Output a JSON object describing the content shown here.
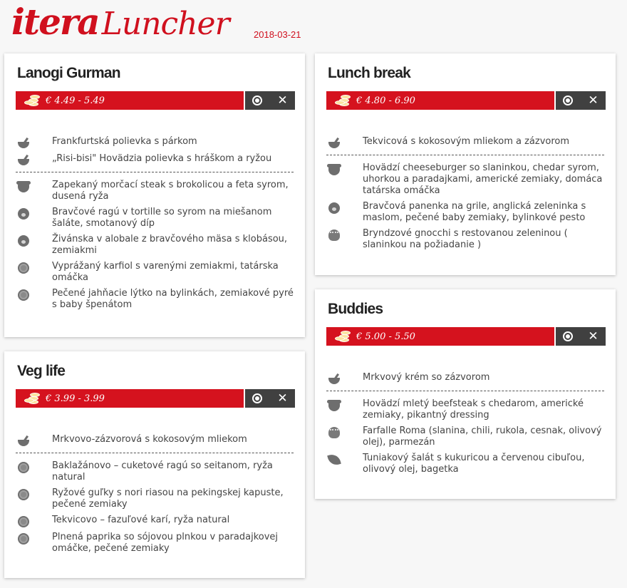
{
  "app": {
    "brand_part1": "itera",
    "brand_part2": "Luncher",
    "date": "2018-03-21"
  },
  "colors": {
    "accent": "#d5121e",
    "action_bar": "#404040"
  },
  "restaurants": {
    "lanogi": {
      "name": "Lanogi Gurman",
      "price": "€ 4.49 - 5.49",
      "soups": [
        {
          "icon": "soup-icon",
          "text": "Frankfurtská polievka s párkom"
        },
        {
          "icon": "soup-icon",
          "text": "„Risi-bisi\" Hovädzia polievka s hráškom a ryžou"
        }
      ],
      "mains": [
        {
          "icon": "cow-icon",
          "text": "Zapekaný morčací steak s brokolicou a feta syrom, dusená ryža"
        },
        {
          "icon": "pig-icon",
          "text": "Bravčové ragú v tortille so syrom na miešanom šaláte, smotanový díp"
        },
        {
          "icon": "pig-icon",
          "text": "Živánska v alobale z bravčového mäsa s klobásou, zemiakmi"
        },
        {
          "icon": "plate-icon",
          "text": "Vyprážaný karfiol s varenými zemiakmi, tatárska omáčka"
        },
        {
          "icon": "plate-icon",
          "text": "Pečené jahňacie lýtko na bylinkách, zemiakové pyré s baby špenátom"
        }
      ]
    },
    "lunchbreak": {
      "name": "Lunch break",
      "price": "€ 4.80 - 6.90",
      "soups": [
        {
          "icon": "soup-icon",
          "text": "Tekvicová s kokosovým mliekom a zázvorom"
        }
      ],
      "mains": [
        {
          "icon": "cow-icon",
          "text": "Hovädzí cheeseburger so slaninkou, chedar syrom, uhorkou a paradajkami, americké zemiaky, domáca tatárska omáčka"
        },
        {
          "icon": "pig-icon",
          "text": "Bravčová panenka na grile, anglická zeleninka s maslom, pečené baby zemiaky, bylinkové pesto"
        },
        {
          "icon": "pasta-icon",
          "text": "Bryndzové gnocchi s restovanou zeleninou ( slaninkou na požiadanie )"
        }
      ]
    },
    "veglife": {
      "name": "Veg life",
      "price": "€ 3.99 - 3.99",
      "soups": [
        {
          "icon": "soup-icon",
          "text": "Mrkvovo-zázvorová s kokosovým mliekom"
        }
      ],
      "mains": [
        {
          "icon": "plate-icon",
          "text": "Baklažánovo – cuketové ragú so seitanom, ryža natural"
        },
        {
          "icon": "plate-icon",
          "text": "Ryžové guľky s nori riasou na pekingskej kapuste, pečené zemiaky"
        },
        {
          "icon": "plate-icon",
          "text": "Tekvicovo – fazuľové karí, ryža natural"
        },
        {
          "icon": "plate-icon",
          "text": "Plnená paprika so sójovou plnkou v paradajkovej omáčke, pečené zemiaky"
        }
      ]
    },
    "buddies": {
      "name": "Buddies",
      "price": "€ 5.00 - 5.50",
      "soups": [
        {
          "icon": "soup-icon",
          "text": "Mrkvový krém so zázvorom"
        }
      ],
      "mains": [
        {
          "icon": "cow-icon",
          "text": "Hovädzí mletý beefsteak s chedarom, americké zemiaky, pikantný dressing"
        },
        {
          "icon": "pasta-icon",
          "text": "Farfalle Roma (slanina, chili, rukola, cesnak, olivový olej), parmezán"
        },
        {
          "icon": "leaf-icon",
          "text": "Tuniakový šalát s kukuricou a červenou cibuľou, olivový olej, bagetka"
        }
      ]
    }
  }
}
